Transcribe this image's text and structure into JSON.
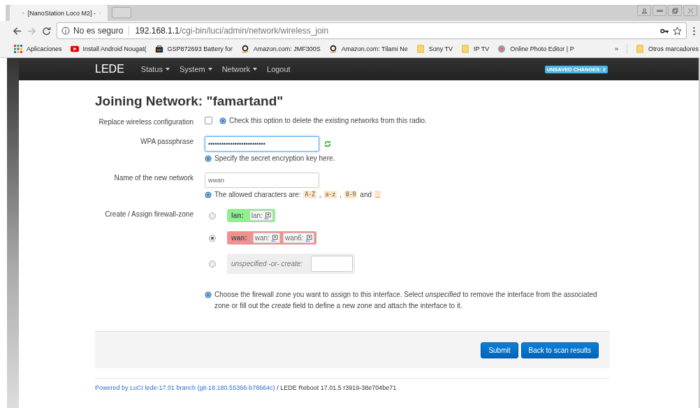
{
  "browser": {
    "tab_title": "[NanoStation Loco M2] -",
    "security": "No es seguro",
    "host": "192.168.1.1",
    "path": "/cgi-bin/luci/admin/network/wireless_join",
    "bookmarks": [
      {
        "label": "Aplicaciones",
        "kind": "apps"
      },
      {
        "label": "Install Android Nougat(",
        "kind": "video"
      },
      {
        "label": "GSP872693 Battery for",
        "kind": "bag"
      },
      {
        "label": "Amazon.com: JMF300S",
        "kind": "amazon"
      },
      {
        "label": "Amazon.com: Tilami Ne",
        "kind": "amazon"
      },
      {
        "label": "Sony TV",
        "kind": "folder"
      },
      {
        "label": "IP TV",
        "kind": "folder"
      },
      {
        "label": "Online Photo Editor | P",
        "kind": "globe"
      }
    ],
    "overflow": "»",
    "other": {
      "label": "Otros marcadores",
      "kind": "folder"
    }
  },
  "navbar": {
    "brand": "LEDE",
    "menu": [
      {
        "label": "Status",
        "dropdown": true
      },
      {
        "label": "System",
        "dropdown": true
      },
      {
        "label": "Network",
        "dropdown": true
      },
      {
        "label": "Logout",
        "dropdown": false
      }
    ],
    "badge": "UNSAVED CHANGES: 2"
  },
  "title": "Joining Network: \"famartand\"",
  "fields": [
    {
      "kind": "checkbox",
      "label": "Replace wireless configuration",
      "checked": false,
      "hint": [
        {
          "kind": "text",
          "text": "Check this option to delete the existing networks from this radio."
        }
      ]
    },
    {
      "kind": "password",
      "label": "WPA passphrase",
      "value": "••••••••••••••••••••••••••",
      "hint": [
        {
          "kind": "text",
          "text": "Specify the secret encryption key here."
        }
      ]
    },
    {
      "kind": "text",
      "label": "Name of the new network",
      "value": "wwan",
      "hint": [
        {
          "kind": "text",
          "text": "The allowed characters are:"
        },
        {
          "kind": "code",
          "text": "A-Z"
        },
        {
          "kind": "text",
          "text": ","
        },
        {
          "kind": "code",
          "text": "a-z"
        },
        {
          "kind": "text",
          "text": ","
        },
        {
          "kind": "code",
          "text": "0-9"
        },
        {
          "kind": "text",
          "text": "and"
        },
        {
          "kind": "code",
          "text": "_"
        }
      ]
    },
    {
      "kind": "zones",
      "label": "Create / Assign firewall-zone",
      "options": [
        {
          "kind": "zone",
          "name": "lan:",
          "color": "#90f090",
          "networks": [
            "lan:"
          ],
          "selected": false
        },
        {
          "kind": "zone",
          "name": "wan:",
          "color": "#f09090",
          "networks": [
            "wan:",
            "wan6:"
          ],
          "selected": true
        },
        {
          "kind": "create",
          "label": "unspecified -or- create:",
          "selected": false
        }
      ],
      "hint_rich": "Choose the firewall zone you want to assign to this interface. Select *unspecified* to remove the interface from the associated zone or fill out the *create* field to define a new zone and attach the interface to it."
    }
  ],
  "buttons": [
    {
      "label": "Submit"
    },
    {
      "label": "Back to scan results"
    }
  ],
  "footer": {
    "link": "Powered by LuCI lede-17.01 branch (git-18.180.55366-b78664c)",
    "text": "/ LEDE Reboot 17.01.5 r3919-38e704be71"
  }
}
